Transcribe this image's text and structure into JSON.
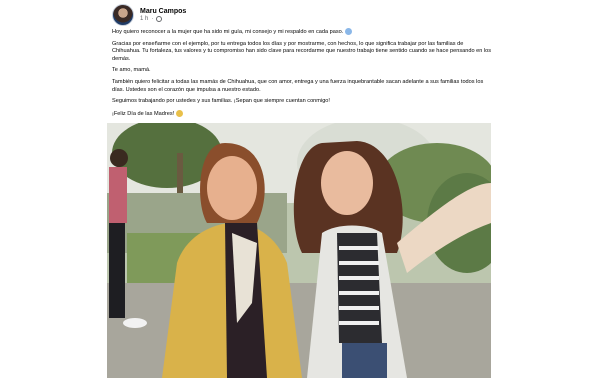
{
  "post": {
    "author": "Maru Campos",
    "time": "1 h",
    "paragraphs": [
      "Hoy quiero reconocer a la mujer que ha sido mi guía, mi consejo y mi respaldo en cada paso.",
      "Gracias por enseñarme con el ejemplo, por tu entrega todos los días y por mostrarme, con hechos, lo que significa trabajar por las familias de Chihuahua. Tu fortaleza, tus valores y tu compromiso han sido clave para recordarme que nuestro trabajo tiene sentido cuando se hace pensando en los demás.",
      "Te amo, mamá.",
      "También quiero felicitar a todas las mamás de Chihuahua, que con amor, entrega y una fuerza inquebrantable sacan adelante a sus familias todos los días. Ustedes son el corazón que impulsa a nuestro estado.",
      "Seguimos trabajando por ustedes y sus familias. ¡Sepan que siempre cuentan conmigo!",
      "¡Feliz Día de las Madres!"
    ],
    "icons": {
      "privacy": "globe-icon",
      "heart": "blue-heart-icon",
      "flower": "flower-icon"
    }
  }
}
